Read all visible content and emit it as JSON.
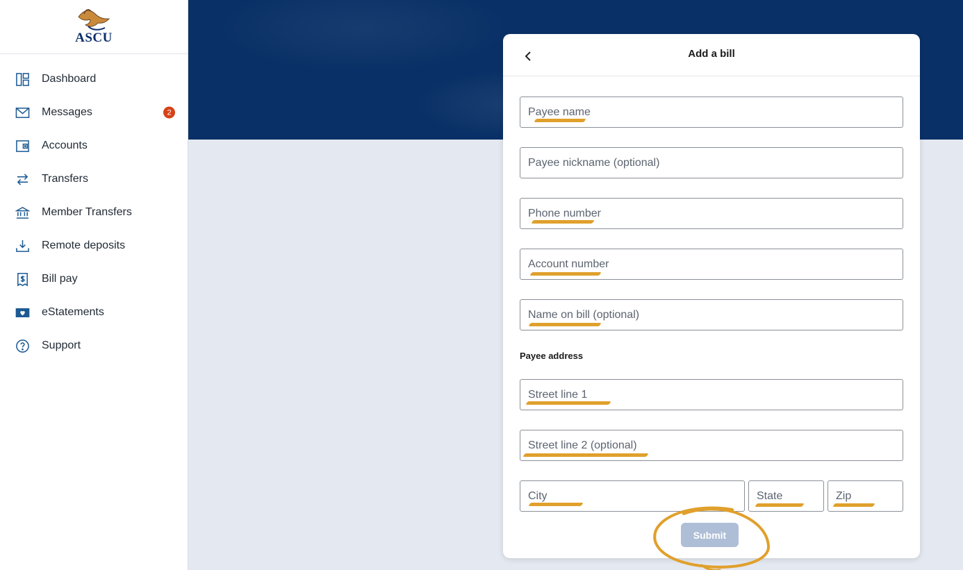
{
  "brand": {
    "name": "ASCU"
  },
  "sidebar": {
    "items": [
      {
        "label": "Dashboard",
        "icon": "dashboard-icon"
      },
      {
        "label": "Messages",
        "icon": "mail-icon",
        "badge": "2"
      },
      {
        "label": "Accounts",
        "icon": "wallet-icon"
      },
      {
        "label": "Transfers",
        "icon": "transfer-arrows-icon"
      },
      {
        "label": "Member Transfers",
        "icon": "bank-icon"
      },
      {
        "label": "Remote deposits",
        "icon": "download-tray-icon"
      },
      {
        "label": "Bill pay",
        "icon": "receipt-dollar-icon"
      },
      {
        "label": "eStatements",
        "icon": "envelope-heart-icon"
      },
      {
        "label": "Support",
        "icon": "help-circle-icon"
      }
    ]
  },
  "form": {
    "title": "Add a bill",
    "payee_name_placeholder": "Payee name",
    "payee_nickname_placeholder": "Payee nickname (optional)",
    "phone_placeholder": "Phone number",
    "account_number_placeholder": "Account number",
    "name_on_bill_placeholder": "Name on bill (optional)",
    "address_label": "Payee address",
    "street1_placeholder": "Street line 1",
    "street2_placeholder": "Street line 2 (optional)",
    "city_placeholder": "City",
    "state_placeholder": "State",
    "zip_placeholder": "Zip",
    "submit_label": "Submit"
  },
  "colors": {
    "primary": "#0a3167",
    "accent_icon": "#1d5a93",
    "badge": "#d64218",
    "submit_disabled": "#aebed6",
    "annotation": "#e0a02c"
  }
}
